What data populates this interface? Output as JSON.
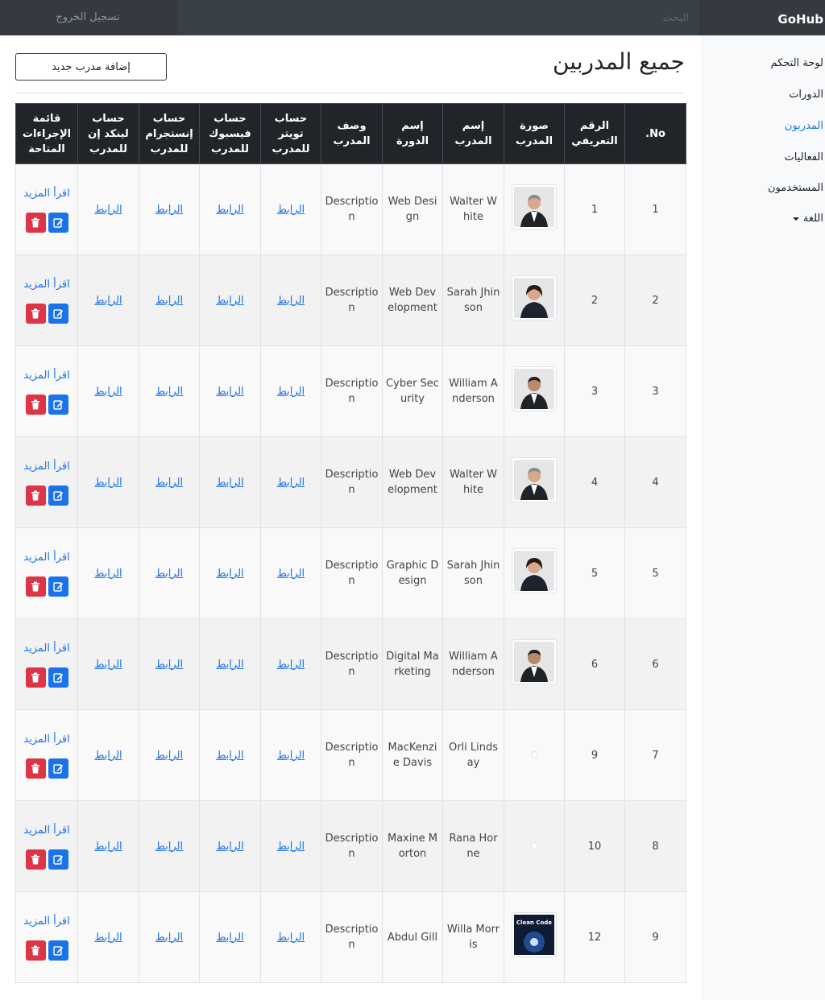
{
  "navbar": {
    "brand": "GoHub",
    "search_placeholder": "البحث",
    "logout": "تسجيل الخروج"
  },
  "sidebar": {
    "items": [
      {
        "label": "لوحة التحكم"
      },
      {
        "label": "الدورات"
      },
      {
        "label": "المدربون"
      },
      {
        "label": "الفعاليات"
      },
      {
        "label": "المستخدمون"
      },
      {
        "label": "اللغة"
      }
    ],
    "active_index": 2
  },
  "page": {
    "title": "جميع المدربين",
    "add_button": "إضافة مدرب جديد"
  },
  "table": {
    "headers": {
      "no": "No.",
      "id": "الرقم التعريفي",
      "photo": "صورة المدرب",
      "name": "إسم المدرب",
      "course": "إسم الدورة",
      "description": "وصف المدرب",
      "twitter": "حساب تويتر للمدرب",
      "facebook": "حساب فيسبوك للمدرب",
      "instagram": "حساب إنستجرام للمدرب",
      "linkedin": "حساب لينكد إن للمدرب",
      "actions": "قائمة الإجراءات المتاحة"
    },
    "link_text": "الرابط",
    "read_more": "اقرأ المزيد",
    "rows": [
      {
        "no": "1",
        "id": "1",
        "photo": "man-gray",
        "name": "Walter White",
        "course": "Web Design",
        "description": "Description"
      },
      {
        "no": "2",
        "id": "2",
        "photo": "woman",
        "name": "Sarah Jhinson",
        "course": "Web Development",
        "description": "Description"
      },
      {
        "no": "3",
        "id": "3",
        "photo": "man-dark",
        "name": "William Anderson",
        "course": "Cyber Security",
        "description": "Description"
      },
      {
        "no": "4",
        "id": "4",
        "photo": "man-gray",
        "name": "Walter White",
        "course": "Web Development",
        "description": "Description"
      },
      {
        "no": "5",
        "id": "5",
        "photo": "woman",
        "name": "Sarah Jhinson",
        "course": "Graphic Design",
        "description": "Description"
      },
      {
        "no": "6",
        "id": "6",
        "photo": "man-dark",
        "name": "William Anderson",
        "course": "Digital Marketing",
        "description": "Description"
      },
      {
        "no": "7",
        "id": "9",
        "photo": "none",
        "name": "Orli Lindsay",
        "course": "MacKenzie Davis",
        "description": "Description"
      },
      {
        "no": "8",
        "id": "10",
        "photo": "none",
        "name": "Rana Horne",
        "course": "Maxine Morton",
        "description": "Description"
      },
      {
        "no": "9",
        "id": "12",
        "photo": "book-cover",
        "name": "Willa Morris",
        "course": "Abdul Gill",
        "description": "Description",
        "photo_text": "Clean Code"
      }
    ]
  },
  "colors": {
    "navbar_bg": "#343a40",
    "table_header_bg": "#212529",
    "link": "#1a73e8",
    "delete_button": "#dc3545",
    "edit_button": "#1a73e8"
  },
  "icons": {
    "delete": "trash-icon",
    "edit": "edit-icon",
    "language_caret": "caret-down-icon"
  }
}
